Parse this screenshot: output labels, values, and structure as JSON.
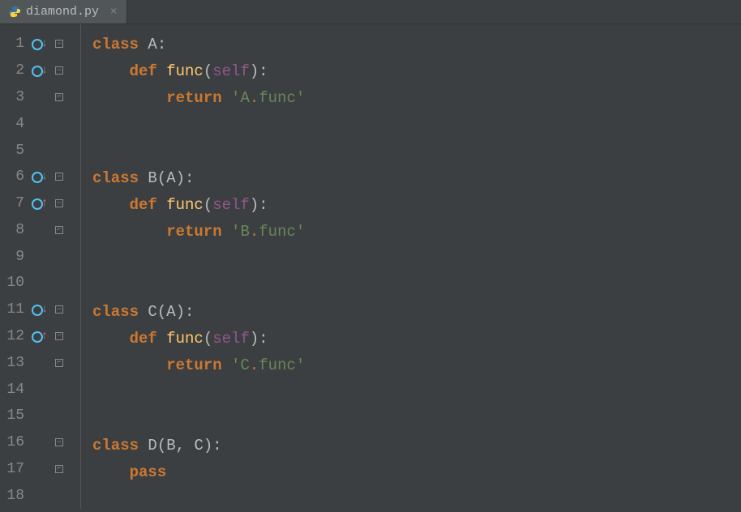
{
  "tab": {
    "filename": "diamond.py",
    "close_symbol": "×"
  },
  "gutter": {
    "lines": [
      {
        "n": "1",
        "marker": "override-down",
        "fold": "minus"
      },
      {
        "n": "2",
        "marker": "override-down",
        "fold": "minus"
      },
      {
        "n": "3",
        "marker": "",
        "fold": "end"
      },
      {
        "n": "4",
        "marker": "",
        "fold": ""
      },
      {
        "n": "5",
        "marker": "",
        "fold": ""
      },
      {
        "n": "6",
        "marker": "override-down",
        "fold": "minus"
      },
      {
        "n": "7",
        "marker": "override-up",
        "fold": "minus"
      },
      {
        "n": "8",
        "marker": "",
        "fold": "end"
      },
      {
        "n": "9",
        "marker": "",
        "fold": ""
      },
      {
        "n": "10",
        "marker": "",
        "fold": ""
      },
      {
        "n": "11",
        "marker": "override-down",
        "fold": "minus"
      },
      {
        "n": "12",
        "marker": "override-up",
        "fold": "minus"
      },
      {
        "n": "13",
        "marker": "",
        "fold": "end"
      },
      {
        "n": "14",
        "marker": "",
        "fold": ""
      },
      {
        "n": "15",
        "marker": "",
        "fold": ""
      },
      {
        "n": "16",
        "marker": "",
        "fold": "minus"
      },
      {
        "n": "17",
        "marker": "",
        "fold": "end"
      },
      {
        "n": "18",
        "marker": "",
        "fold": ""
      }
    ]
  },
  "code": {
    "lines": [
      {
        "indent": 0,
        "tokens": [
          {
            "t": "kw",
            "v": "class "
          },
          {
            "t": "cls",
            "v": "A"
          },
          {
            "t": "punct",
            "v": ":"
          }
        ]
      },
      {
        "indent": 1,
        "tokens": [
          {
            "t": "kw",
            "v": "def "
          },
          {
            "t": "fn",
            "v": "func"
          },
          {
            "t": "punct",
            "v": "("
          },
          {
            "t": "self",
            "v": "self"
          },
          {
            "t": "punct",
            "v": "):"
          }
        ]
      },
      {
        "indent": 2,
        "tokens": [
          {
            "t": "kw",
            "v": "return "
          },
          {
            "t": "str",
            "v": "'A"
          },
          {
            "t": "dot",
            "v": "."
          },
          {
            "t": "str",
            "v": "func'"
          }
        ]
      },
      {
        "indent": 0,
        "tokens": []
      },
      {
        "indent": 0,
        "tokens": []
      },
      {
        "indent": 0,
        "tokens": [
          {
            "t": "kw",
            "v": "class "
          },
          {
            "t": "cls",
            "v": "B(A)"
          },
          {
            "t": "punct",
            "v": ":"
          }
        ]
      },
      {
        "indent": 1,
        "tokens": [
          {
            "t": "kw",
            "v": "def "
          },
          {
            "t": "fn",
            "v": "func"
          },
          {
            "t": "punct",
            "v": "("
          },
          {
            "t": "self",
            "v": "self"
          },
          {
            "t": "punct",
            "v": "):"
          }
        ]
      },
      {
        "indent": 2,
        "tokens": [
          {
            "t": "kw",
            "v": "return "
          },
          {
            "t": "str",
            "v": "'B"
          },
          {
            "t": "dot",
            "v": "."
          },
          {
            "t": "str",
            "v": "func'"
          }
        ]
      },
      {
        "indent": 0,
        "tokens": []
      },
      {
        "indent": 0,
        "tokens": []
      },
      {
        "indent": 0,
        "tokens": [
          {
            "t": "kw",
            "v": "class "
          },
          {
            "t": "cls",
            "v": "C(A)"
          },
          {
            "t": "punct",
            "v": ":"
          }
        ]
      },
      {
        "indent": 1,
        "tokens": [
          {
            "t": "kw",
            "v": "def "
          },
          {
            "t": "fn",
            "v": "func"
          },
          {
            "t": "punct",
            "v": "("
          },
          {
            "t": "self",
            "v": "self"
          },
          {
            "t": "punct",
            "v": "):"
          }
        ]
      },
      {
        "indent": 2,
        "tokens": [
          {
            "t": "kw",
            "v": "return "
          },
          {
            "t": "str",
            "v": "'C"
          },
          {
            "t": "dot",
            "v": "."
          },
          {
            "t": "str",
            "v": "func'"
          }
        ]
      },
      {
        "indent": 0,
        "tokens": []
      },
      {
        "indent": 0,
        "tokens": []
      },
      {
        "indent": 0,
        "tokens": [
          {
            "t": "kw",
            "v": "class "
          },
          {
            "t": "cls",
            "v": "D(B"
          },
          {
            "t": "punct",
            "v": ", "
          },
          {
            "t": "cls",
            "v": "C)"
          },
          {
            "t": "punct",
            "v": ":"
          }
        ]
      },
      {
        "indent": 1,
        "tokens": [
          {
            "t": "kw",
            "v": "pass"
          }
        ]
      },
      {
        "indent": 0,
        "tokens": []
      }
    ]
  }
}
